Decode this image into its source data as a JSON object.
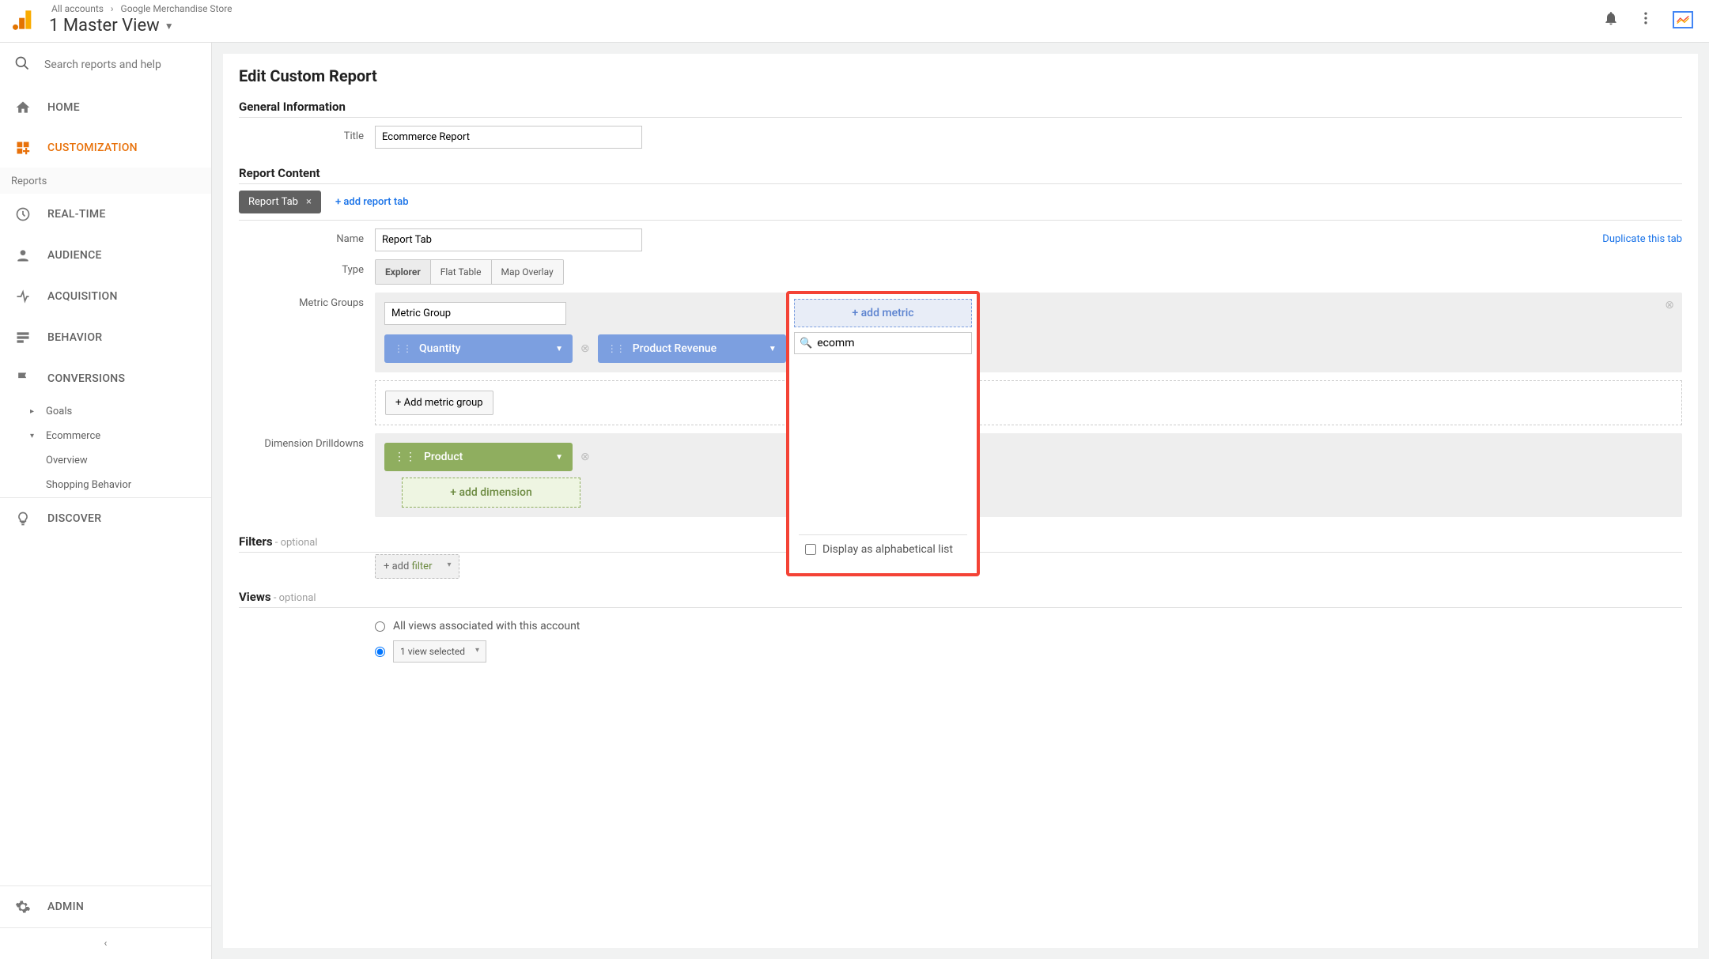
{
  "header": {
    "breadcrumb": {
      "root": "All accounts",
      "sep": "›",
      "property": "Google Merchandise Store"
    },
    "view_title": "1 Master View"
  },
  "sidebar": {
    "search_placeholder": "Search reports and help",
    "items": {
      "home": "HOME",
      "customization": "CUSTOMIZATION",
      "reports_header": "Reports",
      "realtime": "REAL-TIME",
      "audience": "AUDIENCE",
      "acquisition": "ACQUISITION",
      "behavior": "BEHAVIOR",
      "conversions": "CONVERSIONS",
      "goals": "Goals",
      "ecommerce": "Ecommerce",
      "overview": "Overview",
      "shopping": "Shopping Behavior",
      "discover": "DISCOVER",
      "admin": "ADMIN"
    }
  },
  "page": {
    "title": "Edit Custom Report",
    "general_info": "General Information",
    "title_label": "Title",
    "title_value": "Ecommerce Report",
    "report_content": "Report Content",
    "tab_name": "Report Tab",
    "add_tab": "+ add report tab",
    "name_label": "Name",
    "name_value": "Report Tab",
    "duplicate": "Duplicate this tab",
    "type_label": "Type",
    "types": {
      "explorer": "Explorer",
      "flat": "Flat Table",
      "map": "Map Overlay"
    },
    "metric_groups_label": "Metric Groups",
    "metric_group_name": "Metric Group",
    "metrics": {
      "quantity": "Quantity",
      "revenue": "Product Revenue"
    },
    "add_metric": "+ add metric",
    "add_metric_group": "+ Add metric group",
    "dim_label": "Dimension Drilldowns",
    "dim_product": "Product",
    "add_dimension": "+ add dimension",
    "filters_label": "Filters",
    "optional": " - optional",
    "add_filter_prefix": "+ add ",
    "add_filter_word": "filter",
    "views_label": "Views",
    "views_all": "All views associated with this account",
    "views_one": "1 view selected"
  },
  "popover": {
    "add_metric": "+ add metric",
    "search_value": "ecomm",
    "alpha_label": "Display as alphabetical list"
  }
}
